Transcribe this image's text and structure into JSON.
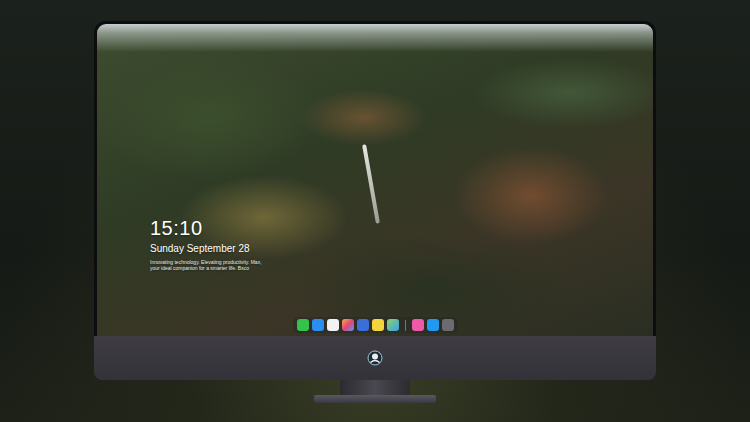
{
  "lock_screen": {
    "time": "15:10",
    "date": "Sunday September 28",
    "tagline": [
      "Innovating technology. Elevating productivity. Max,",
      "your ideal companion for a smarter life. Bsco"
    ]
  }
}
